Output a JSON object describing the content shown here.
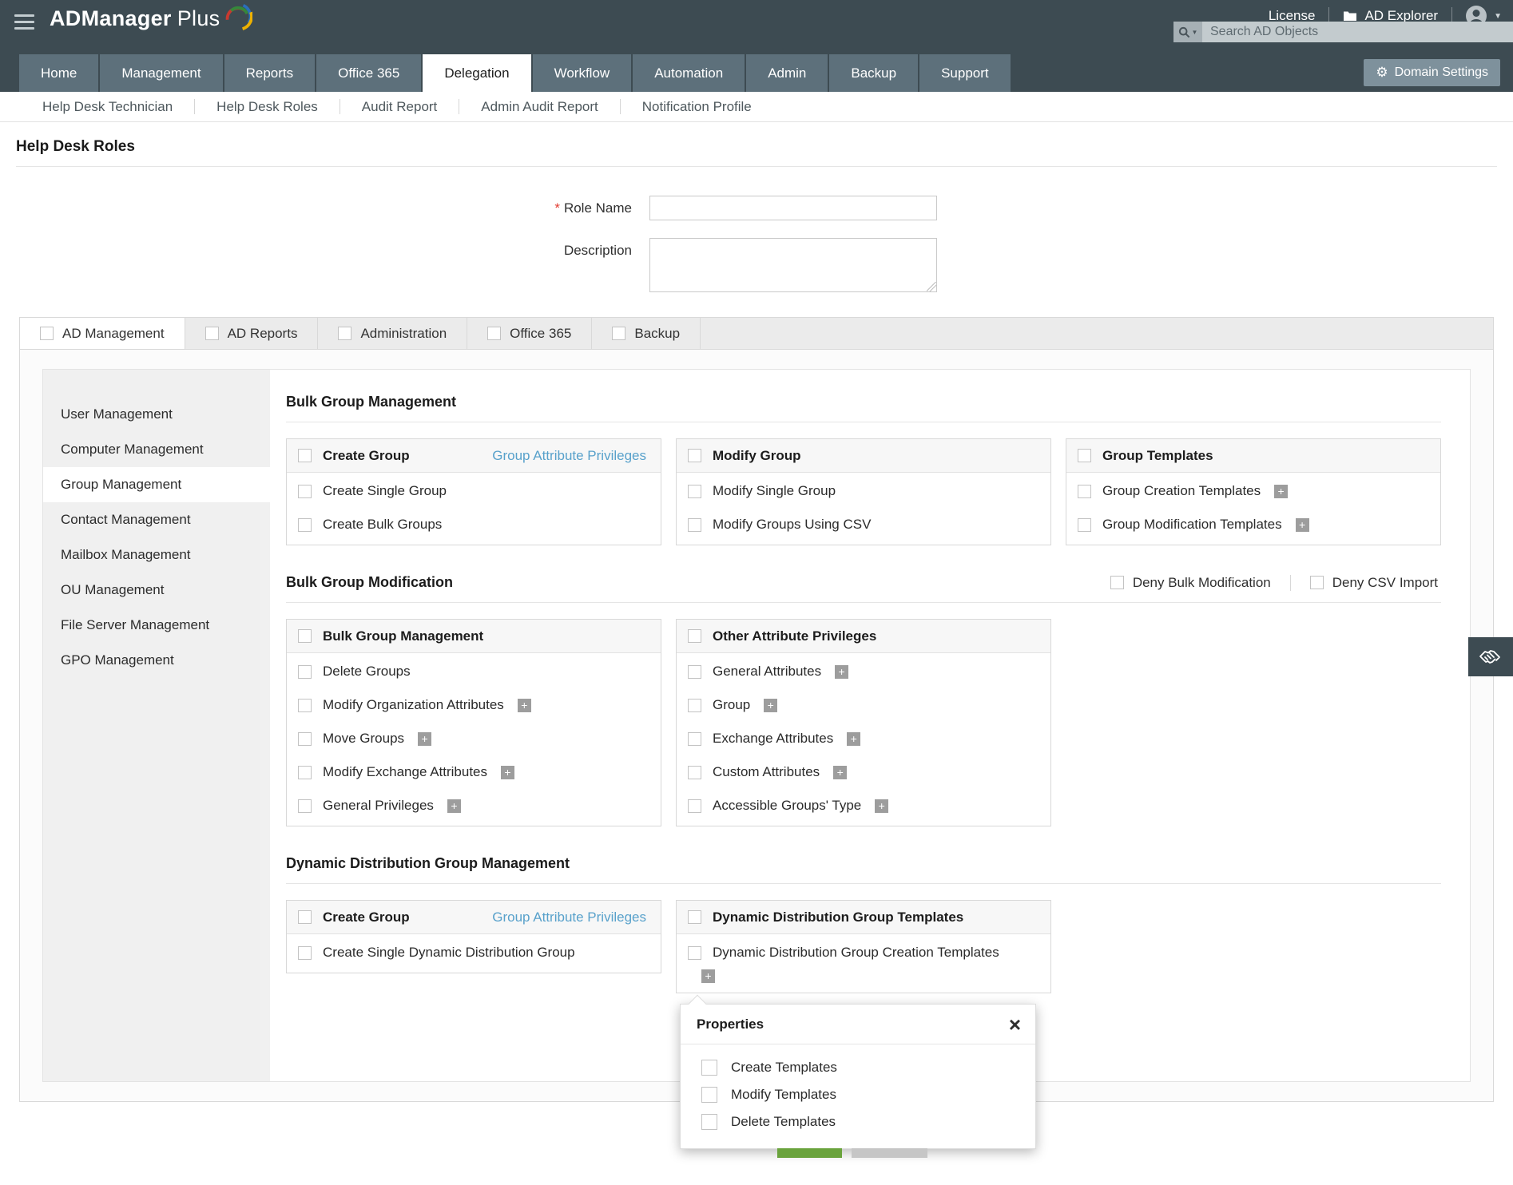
{
  "header": {
    "brand": {
      "name_bold": "ADManager",
      "name_light": "Plus"
    },
    "license_label": "License",
    "ad_explorer_label": "AD Explorer",
    "search_placeholder": "Search AD Objects"
  },
  "nav": {
    "items": [
      "Home",
      "Management",
      "Reports",
      "Office 365",
      "Delegation",
      "Workflow",
      "Automation",
      "Admin",
      "Backup",
      "Support"
    ],
    "active": "Delegation",
    "domain_settings_label": "Domain Settings"
  },
  "subnav": [
    "Help Desk Technician",
    "Help Desk Roles",
    "Audit Report",
    "Admin Audit Report",
    "Notification Profile"
  ],
  "page_title": "Help Desk Roles",
  "form": {
    "required_marker": "*",
    "role_name_label": "Role Name",
    "role_name_value": "",
    "description_label": "Description",
    "description_value": ""
  },
  "tabs": {
    "items": [
      "AD Management",
      "AD Reports",
      "Administration",
      "Office 365",
      "Backup"
    ],
    "active": "AD Management"
  },
  "sidebar": {
    "items": [
      "User Management",
      "Computer Management",
      "Group Management",
      "Contact Management",
      "Mailbox Management",
      "OU Management",
      "File Server Management",
      "GPO Management"
    ],
    "active": "Group Management"
  },
  "sections": [
    {
      "title": "Bulk Group Management",
      "boxes": [
        {
          "header": "Create Group",
          "header_link": "Group Attribute Privileges",
          "items": [
            {
              "label": "Create Single Group"
            },
            {
              "label": "Create Bulk Groups"
            }
          ]
        },
        {
          "header": "Modify Group",
          "items": [
            {
              "label": "Modify Single Group"
            },
            {
              "label": "Modify Groups Using CSV"
            }
          ]
        },
        {
          "header": "Group Templates",
          "items": [
            {
              "label": "Group Creation Templates",
              "plus": true
            },
            {
              "label": "Group Modification Templates",
              "plus": true
            }
          ]
        }
      ]
    },
    {
      "title": "Bulk Group Modification",
      "deny_options": [
        "Deny Bulk Modification",
        "Deny CSV Import"
      ],
      "boxes": [
        {
          "header": "Bulk Group Management",
          "items": [
            {
              "label": "Delete Groups"
            },
            {
              "label": "Modify Organization Attributes",
              "plus": true
            },
            {
              "label": "Move Groups",
              "plus": true
            },
            {
              "label": "Modify Exchange Attributes",
              "plus": true
            },
            {
              "label": "General Privileges",
              "plus": true
            }
          ]
        },
        {
          "header": "Other Attribute Privileges",
          "items": [
            {
              "label": "General Attributes",
              "plus": true
            },
            {
              "label": "Group",
              "plus": true
            },
            {
              "label": "Exchange Attributes",
              "plus": true
            },
            {
              "label": "Custom Attributes",
              "plus": true
            },
            {
              "label": "Accessible Groups' Type",
              "plus": true
            }
          ]
        }
      ]
    },
    {
      "title": "Dynamic Distribution Group Management",
      "boxes": [
        {
          "header": "Create Group",
          "header_link": "Group Attribute Privileges",
          "items": [
            {
              "label": "Create Single Dynamic Distribution Group"
            }
          ]
        },
        {
          "header": "Dynamic Distribution Group Templates",
          "items": [
            {
              "label": "Dynamic Distribution Group Creation Templates",
              "plus_below": true
            }
          ],
          "popup_anchor": true
        }
      ]
    }
  ],
  "popup": {
    "title": "Properties",
    "close_glyph": "×",
    "items": [
      "Create Templates",
      "Modify Templates",
      "Delete Templates"
    ]
  },
  "icons": {
    "gear": "⚙",
    "caret_down": "▼",
    "plus": "+"
  },
  "colors": {
    "header_bg": "#3d4b52",
    "nav_tab_bg": "#5d707b",
    "link_blue": "#58a1cb",
    "save_button_green": "#6aa33c",
    "cancel_button_gray": "#c6c6c6"
  }
}
